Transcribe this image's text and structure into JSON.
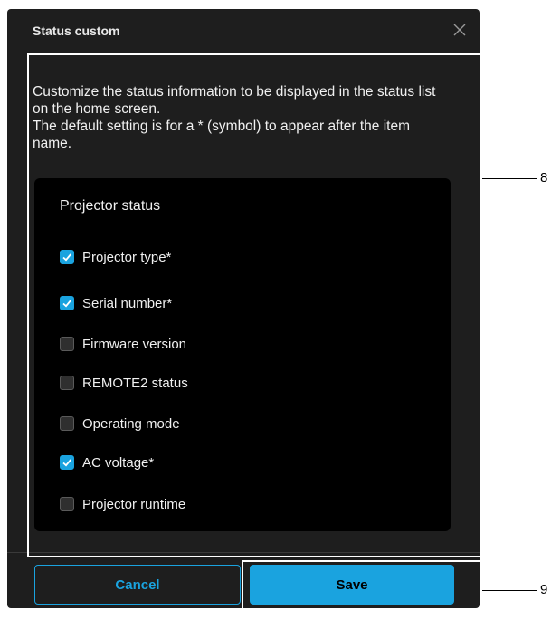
{
  "dialog": {
    "title": "Status custom",
    "close_icon": "close-icon",
    "description": "Customize the status information to be displayed in the status list on the home screen.\nThe default setting is for a * (symbol) to appear after the item name."
  },
  "panel": {
    "title": "Projector status",
    "items": [
      {
        "label": "Projector type*",
        "checked": true
      },
      {
        "label": "Serial number*",
        "checked": true
      },
      {
        "label": "Firmware version",
        "checked": false
      },
      {
        "label": "REMOTE2 status",
        "checked": false
      },
      {
        "label": "Operating mode",
        "checked": false
      },
      {
        "label": "AC voltage*",
        "checked": true
      },
      {
        "label": "Projector runtime",
        "checked": false
      }
    ]
  },
  "buttons": {
    "cancel": "Cancel",
    "save": "Save"
  },
  "callouts": {
    "content": "8",
    "save": "9"
  },
  "colors": {
    "accent": "#1aa3df",
    "dialog_bg": "#1e1e1e",
    "panel_bg": "#000000"
  }
}
